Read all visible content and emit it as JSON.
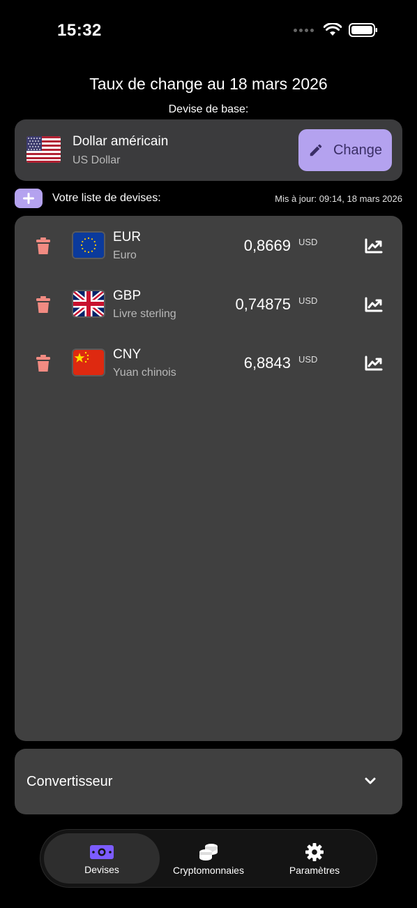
{
  "status": {
    "time": "15:32"
  },
  "header": {
    "title": "Taux de change au 18 mars 2026",
    "base_label": "Devise de base:"
  },
  "base": {
    "name": "Dollar américain",
    "subtitle": "US Dollar",
    "change_label": "Change"
  },
  "list": {
    "title": "Votre liste de devises:",
    "updated": "Mis à jour: 09:14, 18 mars 2026",
    "items": [
      {
        "code": "EUR",
        "name": "Euro",
        "rate": "0,8669",
        "unit": "USD",
        "flag": "eu-flag"
      },
      {
        "code": "GBP",
        "name": "Livre sterling",
        "rate": "0,74875",
        "unit": "USD",
        "flag": "uk-flag"
      },
      {
        "code": "CNY",
        "name": "Yuan chinois",
        "rate": "6,8843",
        "unit": "USD",
        "flag": "china-flag"
      }
    ]
  },
  "converter": {
    "label": "Convertisseur"
  },
  "tabs": [
    {
      "label": "Devises",
      "icon": "banknote-icon"
    },
    {
      "label": "Cryptomonnaies",
      "icon": "coins-icon"
    },
    {
      "label": "Paramètres",
      "icon": "gear-icon"
    }
  ],
  "colors": {
    "accent": "#b4a2ef",
    "danger": "#f28b82",
    "card": "#404040",
    "active_tab_icon": "#7c5cff"
  }
}
